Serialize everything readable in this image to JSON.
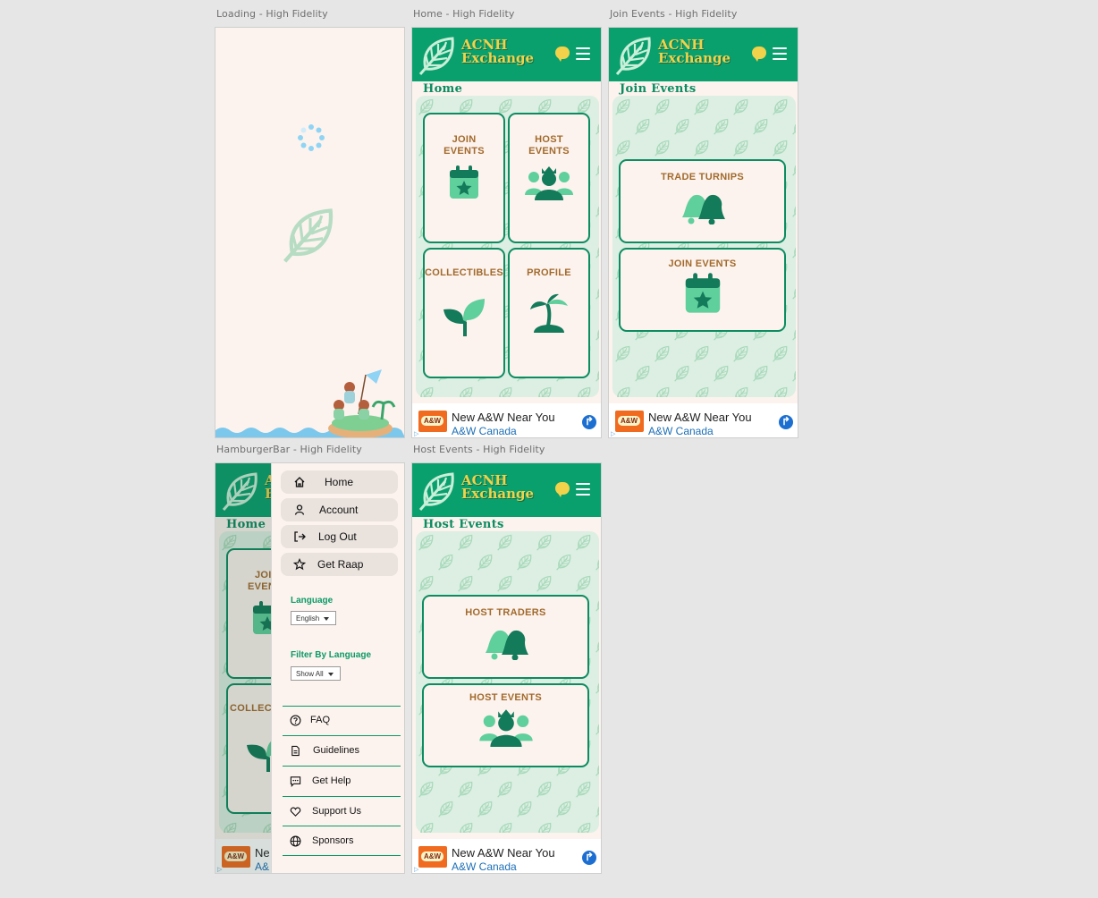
{
  "frames": {
    "loading": {
      "label": "Loading - High Fidelity"
    },
    "home": {
      "label": "Home - High Fidelity",
      "page_title": "Home",
      "cards": [
        "JOIN EVENTS",
        "HOST EVENTS",
        "COLLECTIBLES",
        "PROFILE"
      ],
      "card_icons": [
        "calendar-icon",
        "villagers-icon",
        "sprout-icon",
        "palm-island-icon"
      ]
    },
    "join": {
      "label": "Join Events - High Fidelity",
      "page_title": "Join Events",
      "cards": [
        "TRADE TURNIPS",
        "JOIN EVENTS"
      ],
      "card_icons": [
        "bells-icon",
        "calendar-icon"
      ]
    },
    "hamburger": {
      "label": "HamburgerBar - High Fidelity",
      "page_title": "Home",
      "partial_cards": [
        "JOI",
        "EVEN",
        "COLLEC"
      ]
    },
    "host": {
      "label": "Host Events - High Fidelity",
      "page_title": "Host Events",
      "cards": [
        "HOST TRADERS",
        "HOST EVENTS"
      ],
      "card_icons": [
        "bells-icon",
        "villagers-icon"
      ]
    }
  },
  "brand": {
    "line1": "ACNH",
    "line2": "Exchange"
  },
  "ad": {
    "title": "New A&W Near You",
    "subtitle": "A&W Canada",
    "partial_title": "Ne",
    "partial_subtitle": "A&"
  },
  "menu": {
    "buttons": [
      "Home",
      "Account",
      "Log Out",
      "Get Raap"
    ],
    "language_label": "Language",
    "language_value": "English",
    "filter_label": "Filter By Language",
    "filter_value": "Show All",
    "links": [
      "FAQ",
      "Guidelines",
      "Get Help",
      "Support Us",
      "Sponsors"
    ]
  },
  "colors": {
    "header_green": "#0aa06e",
    "brand_yellow": "#f1d24a",
    "card_border": "#0b8c61",
    "card_text": "#a26a2c",
    "background_cream": "#fcf3ee"
  }
}
